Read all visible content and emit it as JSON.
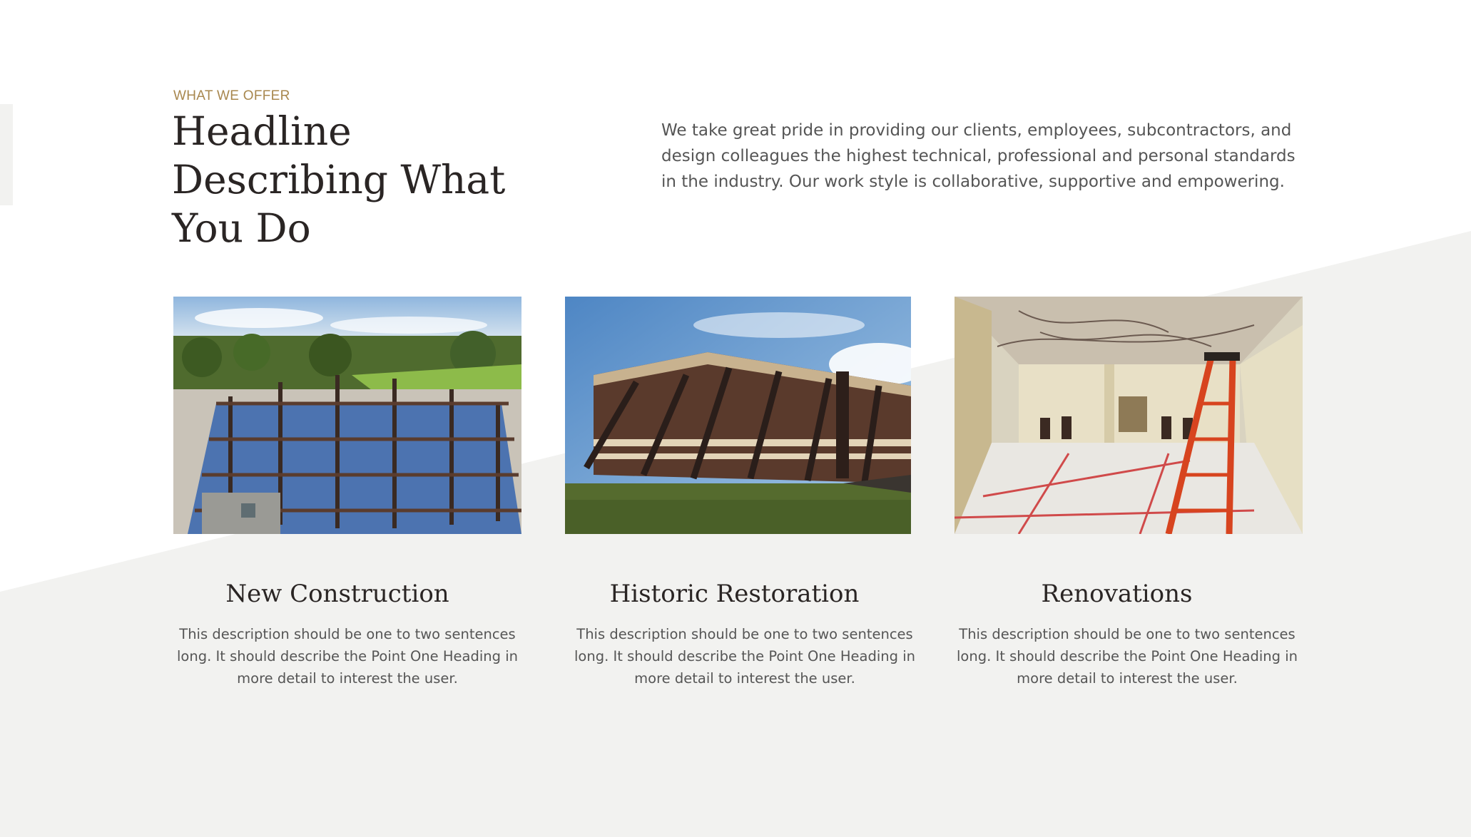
{
  "section": {
    "eyebrow": "WHAT WE OFFER",
    "headline": "Headline Describing What You Do",
    "intro": "We take great pride in providing our clients, employees, subcontractors, and design colleagues the highest technical, professional and personal standards in the industry. Our work style is collaborative, supportive and empowering."
  },
  "services": [
    {
      "title": "New Construction",
      "description": "This description should be one to two sentences long. It should describe the Point One Heading in more detail to interest the user.",
      "image": "steel-frame-construction-photo"
    },
    {
      "title": "Historic Restoration",
      "description": "This description should be one to two sentences long. It should describe the Point One Heading in more detail to interest the user.",
      "image": "braced-brick-building-photo"
    },
    {
      "title": "Renovations",
      "description": "This description should be one to two sentences long. It should describe the Point One Heading in more detail to interest the user.",
      "image": "interior-renovation-ladder-photo"
    }
  ],
  "colors": {
    "accent": "#a8874e",
    "heading": "#2a2524",
    "body": "#555555",
    "band": "#f2f2f0"
  }
}
